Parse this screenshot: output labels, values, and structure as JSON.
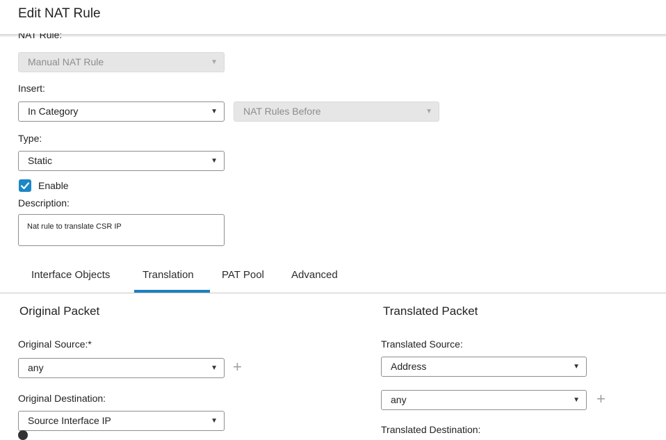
{
  "dialog": {
    "title": "Edit NAT Rule"
  },
  "nat_rule": {
    "label": "NAT Rule:",
    "value": "Manual NAT Rule"
  },
  "insert": {
    "label": "Insert:",
    "value": "In Category",
    "position_value": "NAT Rules Before"
  },
  "type": {
    "label": "Type:",
    "value": "Static"
  },
  "enable": {
    "label": "Enable",
    "checked": true
  },
  "description": {
    "label": "Description:",
    "value": "Nat rule to translate CSR IP"
  },
  "tabs": [
    {
      "label": "Interface Objects",
      "active": false
    },
    {
      "label": "Translation",
      "active": true
    },
    {
      "label": "PAT Pool",
      "active": false
    },
    {
      "label": "Advanced",
      "active": false
    }
  ],
  "original_packet": {
    "title": "Original Packet",
    "source_label": "Original Source:*",
    "source_value": "any",
    "destination_label": "Original Destination:",
    "destination_value": "Source Interface IP"
  },
  "translated_packet": {
    "title": "Translated Packet",
    "source_label": "Translated Source:",
    "source_type_value": "Address",
    "source_value": "any",
    "destination_label": "Translated Destination:"
  },
  "colors": {
    "accent": "#1d7fc2",
    "checkbox": "#1b87c7",
    "disabled_bg": "#e6e6e6"
  },
  "icons": {
    "dropdown": "▼",
    "add": "+"
  }
}
